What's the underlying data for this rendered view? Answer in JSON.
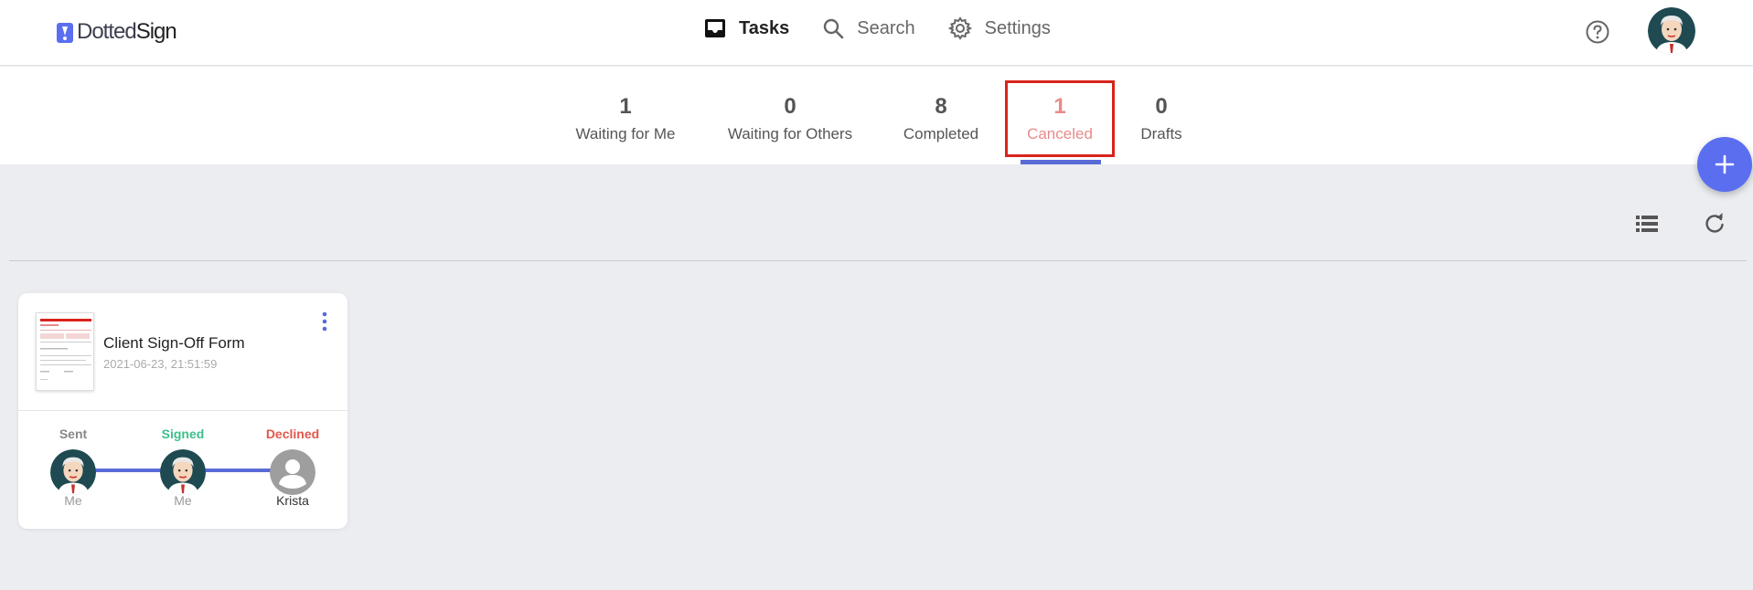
{
  "app": {
    "logo_text_light": "Dotted",
    "logo_text_bold": "Sign",
    "accent_color": "#5b6ef0",
    "canceled_color": "#e88b8b",
    "signed_color": "#3dbf8a",
    "declined_color": "#e2584c"
  },
  "nav": {
    "tasks_label": "Tasks",
    "search_label": "Search",
    "settings_label": "Settings"
  },
  "tabs": [
    {
      "count": "1",
      "label": "Waiting for Me"
    },
    {
      "count": "0",
      "label": "Waiting for Others"
    },
    {
      "count": "8",
      "label": "Completed"
    },
    {
      "count": "1",
      "label": "Canceled"
    },
    {
      "count": "0",
      "label": "Drafts"
    }
  ],
  "card": {
    "title": "Client Sign-Off Form",
    "date": "2021-06-23, 21:51:59",
    "steps": [
      {
        "status": "Sent",
        "who": "Me"
      },
      {
        "status": "Signed",
        "who": "Me"
      },
      {
        "status": "Declined",
        "who": "Krista"
      }
    ]
  }
}
